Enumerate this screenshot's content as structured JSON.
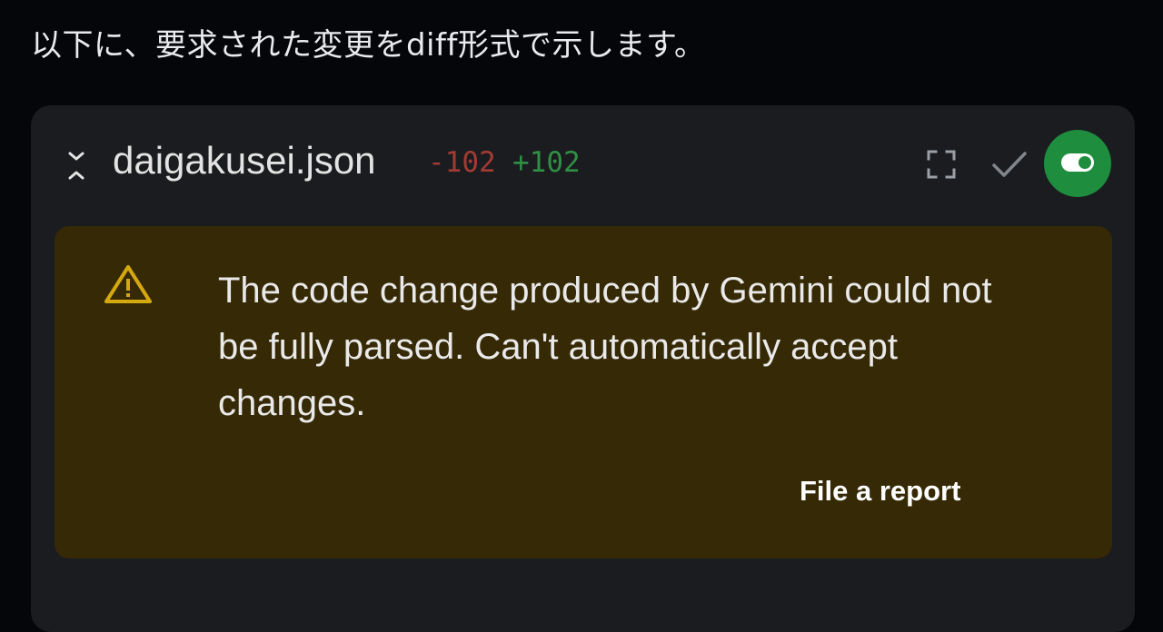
{
  "message": {
    "intro_text": "以下に、要求された変更をdiff形式で示します。"
  },
  "file_card": {
    "file_name": "daigakusei.json",
    "deletions": "-102",
    "additions": "+102",
    "icons": {
      "collapse": "collapse-chevrons-icon",
      "fullscreen": "fullscreen-icon",
      "accept": "check-icon",
      "toggle": "toggle-icon"
    },
    "colors": {
      "deletions": "#a33a33",
      "additions": "#2f8f44",
      "toggle_background": "#1e8e3e",
      "warning_background": "#362905",
      "warning_icon": "#d4a90f"
    }
  },
  "warning": {
    "icon": "warning-triangle-icon",
    "text": "The code change produced by Gemini could not be fully parsed. Can't automatically accept changes.",
    "report_label": "File a report"
  }
}
